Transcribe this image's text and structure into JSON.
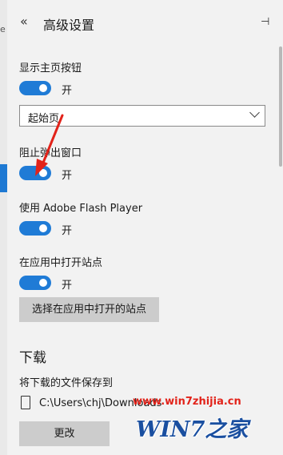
{
  "header": {
    "back_glyph": "«",
    "title": "高级设置",
    "pin_glyph": "⊣"
  },
  "left_edge": {
    "mark": "e"
  },
  "settings": {
    "home_button": {
      "label": "显示主页按钮",
      "toggle_state": "开",
      "on": true
    },
    "home_select": {
      "value": "起始页"
    },
    "popup_block": {
      "label": "阻止弹出窗口",
      "toggle_state": "开",
      "on": true
    },
    "flash": {
      "label": "使用 Adobe Flash Player",
      "toggle_state": "开",
      "on": true
    },
    "open_in_app": {
      "label": "在应用中打开站点",
      "toggle_state": "开",
      "on": true
    },
    "choose_sites_button": "选择在应用中打开的站点"
  },
  "downloads": {
    "section_title": "下载",
    "save_label": "将下载的文件保存到",
    "path": "C:\\Users\\chj\\Downloads",
    "change_button": "更改"
  },
  "watermark": {
    "url": "www.win7zhijia.cn",
    "logo": "WIN7之家"
  },
  "colors": {
    "accent": "#1f7bd6",
    "annotation_arrow": "#e2231a"
  },
  "icons": [
    "back-icon",
    "pin-icon",
    "chevron-down-icon",
    "file-icon"
  ]
}
